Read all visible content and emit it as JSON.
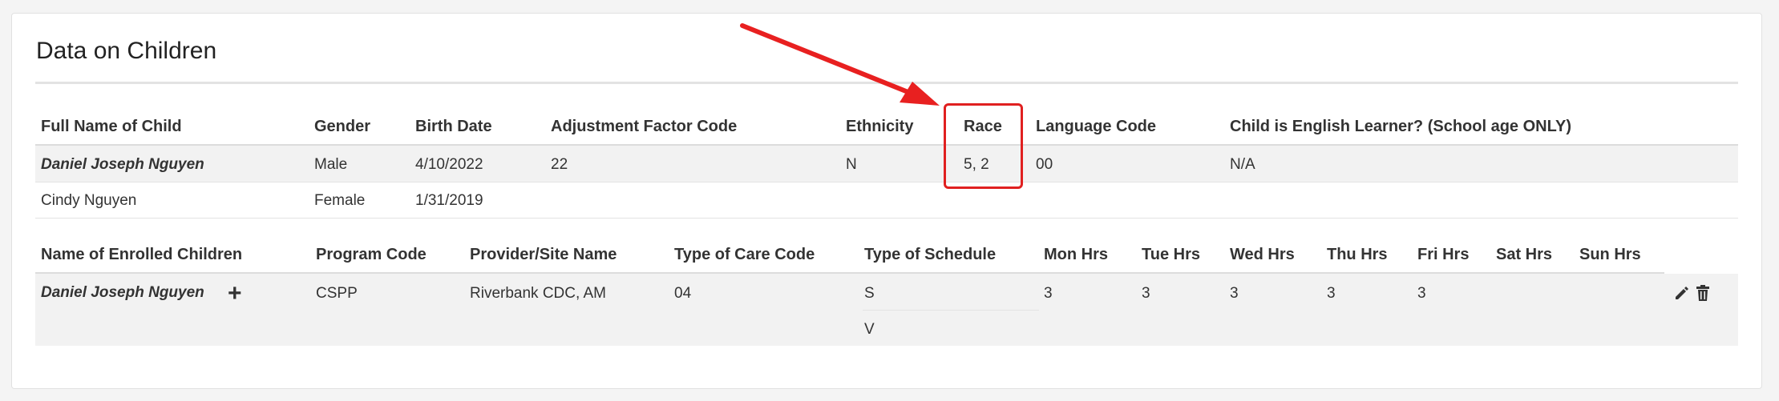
{
  "panel": {
    "title": "Data on Children"
  },
  "children_table": {
    "headers": [
      "Full Name of Child",
      "Gender",
      "Birth Date",
      "Adjustment Factor Code",
      "Ethnicity",
      "Race",
      "Language Code",
      "Child is English Learner? (School age ONLY)"
    ],
    "rows": [
      [
        "Daniel Joseph Nguyen",
        "Male",
        "4/10/2022",
        "22",
        "N",
        "5, 2",
        "00",
        "N/A"
      ],
      [
        "Cindy Nguyen",
        "Female",
        "1/31/2019",
        "",
        "",
        "",
        "",
        ""
      ]
    ]
  },
  "enrolled_table": {
    "headers": [
      "Name of Enrolled Children",
      "Program Code",
      "Provider/Site Name",
      "Type of Care Code",
      "Type of Schedule",
      "Mon Hrs",
      "Tue Hrs",
      "Wed Hrs",
      "Thu Hrs",
      "Fri Hrs",
      "Sat Hrs",
      "Sun Hrs"
    ],
    "row": {
      "name": "Daniel Joseph Nguyen",
      "program_code": "CSPP",
      "provider_site": "Riverbank CDC, AM",
      "care_code": "04",
      "schedules": [
        "S",
        "V"
      ],
      "mon": "3",
      "tue": "3",
      "wed": "3",
      "thu": "3",
      "fri": "3",
      "sat": "",
      "sun": ""
    }
  },
  "icons": {
    "add": "plus-icon",
    "edit": "pencil-icon",
    "delete": "trash-icon"
  },
  "annotation": {
    "highlight_color": "#e02020",
    "target_column": "Race"
  }
}
